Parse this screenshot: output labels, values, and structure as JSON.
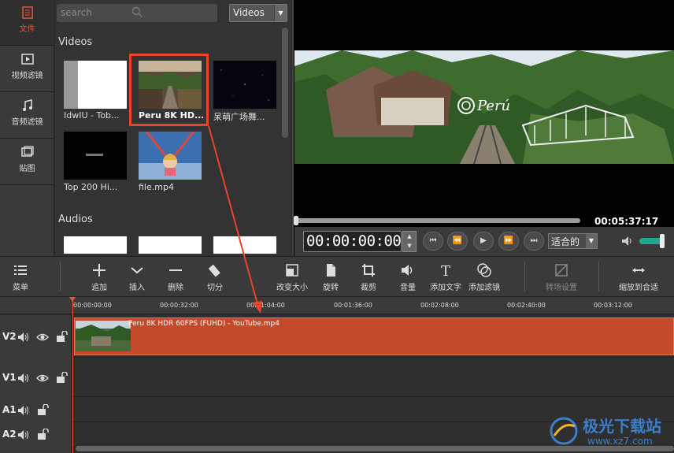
{
  "sidebar": {
    "items": [
      {
        "label": "文件",
        "icon": "file-icon",
        "active": true
      },
      {
        "label": "视频滤镜",
        "icon": "video-filter-icon"
      },
      {
        "label": "音频滤镜",
        "icon": "audio-filter-icon"
      },
      {
        "label": "贴图",
        "icon": "sticker-icon"
      }
    ]
  },
  "browser": {
    "search_placeholder": "search",
    "type_select": "Videos",
    "videos_title": "Videos",
    "audios_title": "Audios",
    "videos": [
      {
        "label": "IdwIU - Tob..."
      },
      {
        "label": "Peru 8K HD...",
        "selected": true
      },
      {
        "label": "呆萌广场舞..."
      },
      {
        "label": "Top 200 Hi..."
      },
      {
        "label": "file.mp4"
      }
    ]
  },
  "preview": {
    "duration": "00:05:37:17",
    "timecode": "00:00:00:00",
    "fit_select": "适合的",
    "overlay_logo_text": "Perú",
    "progress": 0
  },
  "toolbar": {
    "menu": "菜单",
    "append": "追加",
    "insert": "插入",
    "delete": "删除",
    "cut": "切分",
    "resize": "改变大小",
    "rotate": "旋转",
    "crop": "裁剪",
    "volume": "音量",
    "add_text": "添加文字",
    "add_filter": "添加滤镜",
    "transition": "转场设置",
    "zoom_fit": "缩放到合适"
  },
  "timeline": {
    "ticks": [
      "00:00:00:00",
      "00:00:32:00",
      "00:01:04:00",
      "00:01:36:00",
      "00:02:08:00",
      "00:02:40:00",
      "00:03:12:00"
    ],
    "tracks": [
      {
        "name": "V2"
      },
      {
        "name": "V1"
      },
      {
        "name": "A1"
      },
      {
        "name": "A2"
      }
    ],
    "clip_label": "Peru 8K HDR 60FPS (FUHD) - YouTube.mp4"
  },
  "watermark": {
    "text": "极光下载站",
    "url": "www.xz7.com"
  },
  "colors": {
    "accent": "#e8553b",
    "clip": "#c44a2c",
    "volume": "#1fa78f"
  }
}
